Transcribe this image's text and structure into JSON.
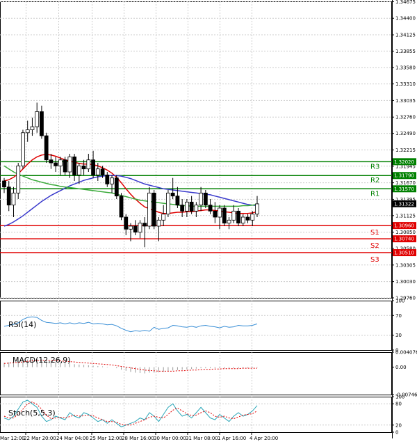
{
  "chart_data": [
    {
      "type": "candlestick",
      "panel": "price",
      "ylim": [
        1.2976,
        1.3468
      ],
      "y_ticks": [
        "1.34675",
        "1.34400",
        "1.34125",
        "1.33855",
        "1.33580",
        "1.33310",
        "1.33035",
        "1.32760",
        "1.32490",
        "1.32215",
        "1.31945",
        "1.31670",
        "1.31395",
        "1.31125",
        "1.30850",
        "1.30580",
        "1.30305",
        "1.30030",
        "1.29760"
      ],
      "x_ticks": [
        "Mar 12:00",
        "22 Mar 20:00",
        "24 Mar 04:00",
        "25 Mar 12:00",
        "28 Mar 16:00",
        "30 Mar 00:00",
        "31 Mar 08:00",
        "1 Apr 16:00",
        "4 Apr 20:00"
      ],
      "current_price": "1.31322",
      "levels": [
        {
          "name": "R3",
          "value": 1.3202,
          "label": "1.32020",
          "color": "#008000"
        },
        {
          "name": "R2",
          "value": 1.3179,
          "label": "1.31790",
          "color": "#008000"
        },
        {
          "name": "R1",
          "value": 1.3157,
          "label": "1.31570",
          "color": "#008000"
        },
        {
          "name": "S1",
          "value": 1.3096,
          "label": "1.30960",
          "color": "#e00000"
        },
        {
          "name": "S2",
          "value": 1.3074,
          "label": "1.30740",
          "color": "#e00000"
        },
        {
          "name": "S3",
          "value": 1.3051,
          "label": "1.30510",
          "color": "#e00000"
        }
      ],
      "candles": [
        [
          1.317,
          1.3175,
          1.315,
          1.316
        ],
        [
          1.316,
          1.317,
          1.312,
          1.313
        ],
        [
          1.313,
          1.316,
          1.311,
          1.315
        ],
        [
          1.315,
          1.32,
          1.314,
          1.3195
        ],
        [
          1.3195,
          1.3255,
          1.319,
          1.325
        ],
        [
          1.325,
          1.327,
          1.3235,
          1.3255
        ],
        [
          1.3255,
          1.3275,
          1.3245,
          1.326
        ],
        [
          1.326,
          1.33,
          1.325,
          1.3285
        ],
        [
          1.3285,
          1.3295,
          1.324,
          1.3245
        ],
        [
          1.3245,
          1.325,
          1.32,
          1.3205
        ],
        [
          1.3205,
          1.3215,
          1.319,
          1.32
        ],
        [
          1.32,
          1.321,
          1.3185,
          1.3195
        ],
        [
          1.3195,
          1.321,
          1.318,
          1.3205
        ],
        [
          1.3205,
          1.321,
          1.318,
          1.3185
        ],
        [
          1.3185,
          1.3215,
          1.3175,
          1.321
        ],
        [
          1.321,
          1.3215,
          1.317,
          1.318
        ],
        [
          1.318,
          1.32,
          1.3165,
          1.3195
        ],
        [
          1.3195,
          1.3205,
          1.318,
          1.319
        ],
        [
          1.319,
          1.3215,
          1.3185,
          1.3205
        ],
        [
          1.3205,
          1.322,
          1.3175,
          1.318
        ],
        [
          1.318,
          1.32,
          1.317,
          1.319
        ],
        [
          1.319,
          1.3195,
          1.3175,
          1.318
        ],
        [
          1.318,
          1.3185,
          1.316,
          1.3165
        ],
        [
          1.3165,
          1.318,
          1.315,
          1.3175
        ],
        [
          1.3175,
          1.318,
          1.314,
          1.3145
        ],
        [
          1.3145,
          1.315,
          1.3105,
          1.311
        ],
        [
          1.311,
          1.3115,
          1.308,
          1.309
        ],
        [
          1.309,
          1.31,
          1.307,
          1.3095
        ],
        [
          1.3095,
          1.3105,
          1.308,
          1.3085
        ],
        [
          1.3085,
          1.3105,
          1.3075,
          1.31
        ],
        [
          1.31,
          1.311,
          1.306,
          1.3095
        ],
        [
          1.3095,
          1.316,
          1.309,
          1.315
        ],
        [
          1.315,
          1.3155,
          1.309,
          1.3095
        ],
        [
          1.3095,
          1.311,
          1.307,
          1.3105
        ],
        [
          1.3105,
          1.313,
          1.3095,
          1.3115
        ],
        [
          1.3115,
          1.3155,
          1.311,
          1.315
        ],
        [
          1.315,
          1.3175,
          1.314,
          1.3145
        ],
        [
          1.3145,
          1.316,
          1.3125,
          1.313
        ],
        [
          1.313,
          1.314,
          1.311,
          1.312
        ],
        [
          1.312,
          1.314,
          1.311,
          1.3135
        ],
        [
          1.3135,
          1.3145,
          1.3115,
          1.312
        ],
        [
          1.312,
          1.3135,
          1.311,
          1.313
        ],
        [
          1.313,
          1.316,
          1.312,
          1.315
        ],
        [
          1.315,
          1.3155,
          1.3125,
          1.313
        ],
        [
          1.313,
          1.314,
          1.3115,
          1.312
        ],
        [
          1.312,
          1.3135,
          1.31,
          1.311
        ],
        [
          1.311,
          1.313,
          1.309,
          1.3125
        ],
        [
          1.3125,
          1.313,
          1.3095,
          1.31
        ],
        [
          1.31,
          1.311,
          1.309,
          1.3105
        ],
        [
          1.3105,
          1.313,
          1.31,
          1.312
        ],
        [
          1.312,
          1.3125,
          1.3095,
          1.31
        ],
        [
          1.31,
          1.3115,
          1.3095,
          1.311
        ],
        [
          1.311,
          1.3115,
          1.31,
          1.3105
        ],
        [
          1.3105,
          1.312,
          1.3095,
          1.3115
        ],
        [
          1.3115,
          1.3145,
          1.311,
          1.3132
        ]
      ],
      "series": [
        {
          "name": "",
          "color": "#e00000",
          "values": [
            1.317,
            1.3172,
            1.3176,
            1.3182,
            1.319,
            1.3198,
            1.3205,
            1.321,
            1.3213,
            1.3214,
            1.3213,
            1.3211,
            1.3208,
            1.3205,
            1.3203,
            1.3201,
            1.3199,
            1.3198,
            1.3198,
            1.3197,
            1.3195,
            1.3192,
            1.3188,
            1.3183,
            1.3176,
            1.3167,
            1.3157,
            1.3148,
            1.314,
            1.3133,
            1.3127,
            1.3124,
            1.3121,
            1.3118,
            1.3116,
            1.3116,
            1.3117,
            1.3118,
            1.3118,
            1.3119,
            1.3119,
            1.312,
            1.3121,
            1.3122,
            1.3122,
            1.3121,
            1.312,
            1.3119,
            1.3118,
            1.3117,
            1.3116,
            1.3116,
            1.3116,
            1.3117,
            1.3119
          ]
        },
        {
          "name": "",
          "color": "#3a3acc",
          "values": [
            1.3095,
            1.3098,
            1.3102,
            1.3107,
            1.3112,
            1.3118,
            1.3124,
            1.313,
            1.3136,
            1.3141,
            1.3146,
            1.315,
            1.3154,
            1.3158,
            1.3162,
            1.3165,
            1.3168,
            1.3171,
            1.3173,
            1.3175,
            1.3177,
            1.3178,
            1.3179,
            1.3179,
            1.3179,
            1.3178,
            1.3176,
            1.3174,
            1.3171,
            1.3168,
            1.3165,
            1.3163,
            1.3161,
            1.3159,
            1.3157,
            1.3156,
            1.3155,
            1.3154,
            1.3153,
            1.3152,
            1.3151,
            1.315,
            1.3149,
            1.3148,
            1.3147,
            1.3145,
            1.3143,
            1.3141,
            1.3139,
            1.3137,
            1.3135,
            1.3133,
            1.3131,
            1.313,
            1.3129
          ]
        },
        {
          "name": "",
          "color": "#3aaa3a",
          "values": [
            1.3195,
            1.319,
            1.3185,
            1.3181,
            1.3178,
            1.3175,
            1.3172,
            1.317,
            1.3168,
            1.3166,
            1.3164,
            1.3163,
            1.3161,
            1.316,
            1.3159,
            1.3158,
            1.3157,
            1.3156,
            1.3155,
            1.3154,
            1.3153,
            1.3152,
            1.3151,
            1.315,
            1.3148,
            1.3146,
            1.3144,
            1.3142,
            1.314,
            1.3138,
            1.3137,
            1.3136,
            1.3135,
            1.3134,
            1.3133,
            1.3132,
            1.3131,
            1.313,
            1.3129,
            1.3129,
            1.3128,
            1.3128,
            1.3128,
            1.3128,
            1.3128,
            1.3128,
            1.3128,
            1.3128,
            1.3128,
            1.3128,
            1.3128,
            1.3129,
            1.3129,
            1.313,
            1.3131
          ]
        }
      ]
    },
    {
      "type": "line",
      "panel": "rsi",
      "title": "RSI(14)",
      "ylim": [
        0,
        100
      ],
      "y_ticks": [
        "100",
        "70",
        "30",
        "0"
      ],
      "series": [
        {
          "name": "RSI(14)",
          "color": "#3a8fd6",
          "values": [
            48,
            50,
            52,
            55,
            62,
            66,
            67,
            66,
            60,
            56,
            55,
            54,
            55,
            53,
            55,
            53,
            55,
            54,
            56,
            53,
            54,
            53,
            51,
            52,
            49,
            44,
            40,
            37,
            39,
            38,
            40,
            38,
            46,
            42,
            44,
            45,
            50,
            49,
            47,
            46,
            48,
            46,
            49,
            50,
            48,
            47,
            45,
            48,
            46,
            47,
            50,
            49,
            49,
            50,
            53
          ]
        }
      ]
    },
    {
      "type": "bar",
      "panel": "macd",
      "title": "MACD(12,26,9)",
      "ylim": [
        -0.007466,
        0.004076
      ],
      "y_ticks": [
        "0.004076",
        "0.00",
        "-0.007466"
      ],
      "series": [
        {
          "name": "MACD(12,26,9)",
          "color": "#999999",
          "values": [
            0.0012,
            0.0013,
            0.0014,
            0.0016,
            0.0019,
            0.0021,
            0.0022,
            0.0022,
            0.0021,
            0.0019,
            0.0017,
            0.0015,
            0.0013,
            0.0011,
            0.001,
            0.0008,
            0.0007,
            0.0006,
            0.0005,
            0.0004,
            0.0003,
            0.0002,
            0.0001,
            0,
            -0.0003,
            -0.0007,
            -0.001,
            -0.0013,
            -0.0015,
            -0.0016,
            -0.0017,
            -0.0015,
            -0.0015,
            -0.0014,
            -0.0013,
            -0.0011,
            -0.0009,
            -0.0008,
            -0.0007,
            -0.0006,
            -0.0005,
            -0.0004,
            -0.0003,
            -0.0003,
            -0.0003,
            -0.0003,
            -0.0003,
            -0.0003,
            -0.0003,
            -0.0003,
            -0.0003,
            -0.0003,
            -0.0002,
            -0.0002,
            -0.0001
          ]
        },
        {
          "name": "",
          "color": "#e00000",
          "values": [
            0.001,
            0.0011,
            0.0012,
            0.0013,
            0.0014,
            0.0016,
            0.0017,
            0.0018,
            0.0019,
            0.0019,
            0.0019,
            0.0018,
            0.0017,
            0.0016,
            0.0015,
            0.0014,
            0.0013,
            0.0012,
            0.0011,
            0.001,
            0.0009,
            0.0008,
            0.0007,
            0.0006,
            0.0004,
            0.0002,
            0.0,
            -0.0002,
            -0.0004,
            -0.0006,
            -0.0008,
            -0.0009,
            -0.001,
            -0.0011,
            -0.0011,
            -0.0011,
            -0.0011,
            -0.001,
            -0.001,
            -0.0009,
            -0.0008,
            -0.0008,
            -0.0007,
            -0.0006,
            -0.0006,
            -0.0005,
            -0.0005,
            -0.0004,
            -0.0004,
            -0.0004,
            -0.0004,
            -0.0003,
            -0.0003,
            -0.0003,
            -0.0003
          ]
        }
      ]
    },
    {
      "type": "line",
      "panel": "stoch",
      "title": "Stoch(5,5,3)",
      "ylim": [
        0,
        100
      ],
      "y_ticks": [
        "100",
        "80",
        "20",
        "0"
      ],
      "series": [
        {
          "name": "Stoch(5,5,3)",
          "color": "#2aa6b8",
          "values": [
            40,
            35,
            45,
            65,
            85,
            90,
            80,
            70,
            45,
            30,
            35,
            45,
            40,
            35,
            55,
            45,
            40,
            55,
            50,
            40,
            30,
            35,
            25,
            35,
            25,
            15,
            20,
            25,
            30,
            40,
            35,
            55,
            45,
            30,
            50,
            70,
            80,
            60,
            45,
            50,
            40,
            55,
            70,
            55,
            40,
            35,
            50,
            40,
            30,
            45,
            55,
            45,
            50,
            60,
            75
          ]
        },
        {
          "name": "",
          "color": "#e00000",
          "values": [
            45,
            40,
            40,
            50,
            65,
            80,
            85,
            78,
            65,
            48,
            38,
            40,
            42,
            40,
            44,
            48,
            45,
            46,
            48,
            46,
            40,
            35,
            30,
            30,
            28,
            22,
            20,
            20,
            25,
            30,
            35,
            42,
            45,
            42,
            40,
            50,
            62,
            68,
            60,
            52,
            47,
            48,
            55,
            60,
            55,
            45,
            42,
            45,
            40,
            38,
            43,
            48,
            50,
            52,
            60
          ]
        }
      ]
    }
  ]
}
